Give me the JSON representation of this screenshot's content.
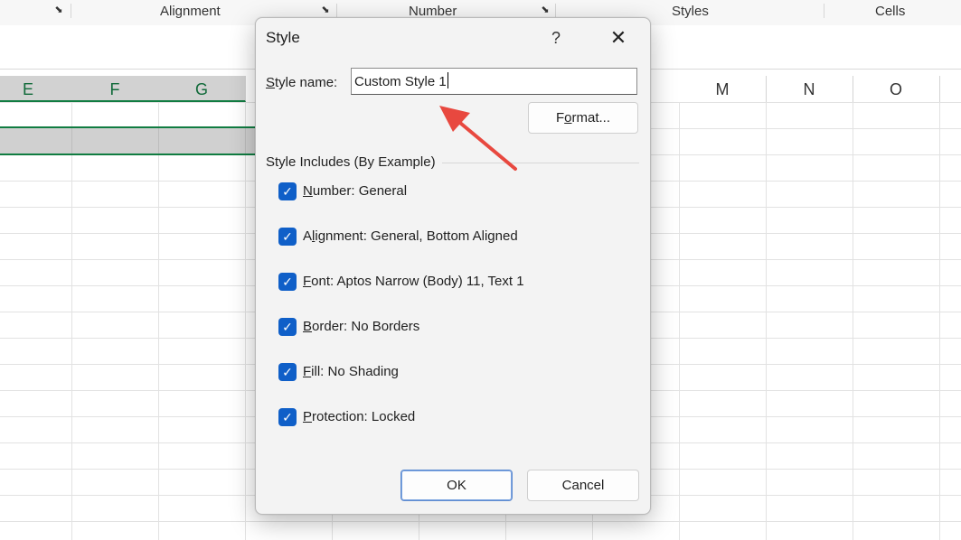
{
  "ribbon": {
    "groups": [
      "Alignment",
      "Number",
      "Styles",
      "Cells"
    ]
  },
  "sheet": {
    "columns_left": [
      "E",
      "F",
      "G"
    ],
    "columns_right": [
      "M",
      "N",
      "O"
    ]
  },
  "dialog": {
    "title": "Style",
    "help_label": "?",
    "close_label": "✕",
    "style_name_label_pre": "S",
    "style_name_label_post": "tyle name:",
    "style_name_value": "Custom Style 1",
    "format_label_pre": "F",
    "format_label_post": "ormat...",
    "group_caption": "Style Includes (By Example)",
    "options": [
      {
        "u": "N",
        "rest": "umber: General",
        "checked": true
      },
      {
        "u": "l",
        "pre": "A",
        "rest": "ignment: General, Bottom Aligned",
        "checked": true
      },
      {
        "u": "F",
        "rest": "ont: Aptos Narrow (Body) 11, Text 1",
        "checked": true
      },
      {
        "u": "B",
        "rest": "order: No Borders",
        "checked": true
      },
      {
        "u": "F",
        "rest": "ill: No Shading",
        "checked": true
      },
      {
        "u": "P",
        "rest": "rotection: Locked",
        "checked": true
      }
    ],
    "ok_label": "OK",
    "cancel_label": "Cancel"
  },
  "colors": {
    "accent": "#107c41",
    "checkbox": "#0f5fc8",
    "annotation_arrow": "#e8483f"
  }
}
